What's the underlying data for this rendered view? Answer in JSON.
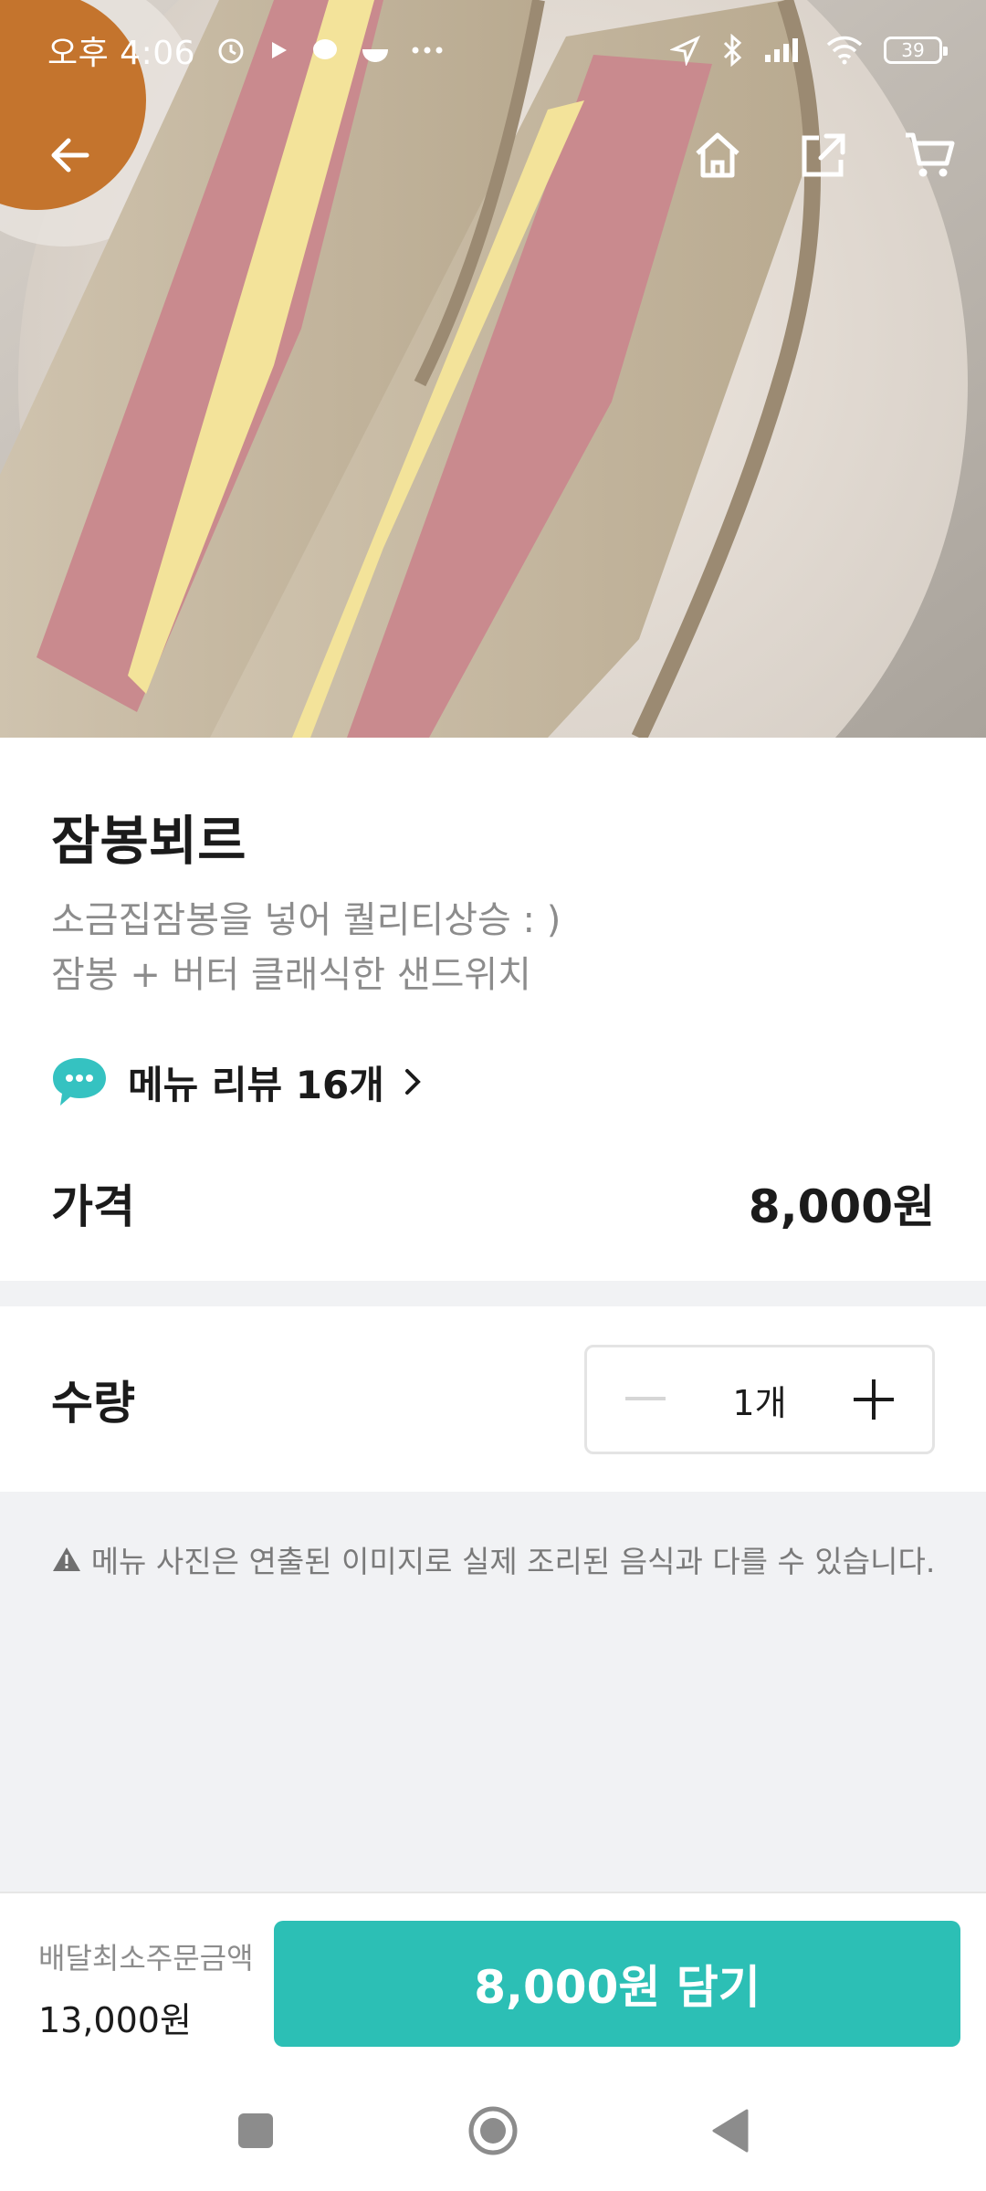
{
  "status_bar": {
    "time": "오후 4:06",
    "battery": "39"
  },
  "product": {
    "name": "잠봉뵈르",
    "description_lines": [
      "소금집잠봉을 넣어 퀄리티상승 : )",
      "잠봉 + 버터 클래식한 샌드위치"
    ]
  },
  "review_link": {
    "label": "메뉴 리뷰 16개"
  },
  "price": {
    "label": "가격",
    "value": "8,000원"
  },
  "quantity": {
    "label": "수량",
    "value": "1개"
  },
  "notice": "메뉴 사진은 연출된 이미지로 실제 조리된 음식과 다를 수 있습니다.",
  "bottom_bar": {
    "min_order_label": "배달최소주문금액",
    "min_order_value": "13,000원",
    "cart_button": "8,000원 담기"
  },
  "colors": {
    "accent": "#2cbfb5",
    "gray_band": "#f1f2f4",
    "text_primary": "#1b1b1b",
    "text_secondary": "#8c8c8c"
  },
  "icons": {
    "nav": [
      "back-arrow-icon",
      "home-icon",
      "share-icon",
      "cart-icon"
    ],
    "status": [
      "alarm-icon",
      "location-icon",
      "bluetooth-icon",
      "signal-icon",
      "wifi-icon",
      "battery-icon"
    ],
    "review": "speech-bubble-icon",
    "notice": "warning-icon",
    "system_nav": [
      "recent-apps-icon",
      "home-circle-icon",
      "back-triangle-icon"
    ]
  }
}
